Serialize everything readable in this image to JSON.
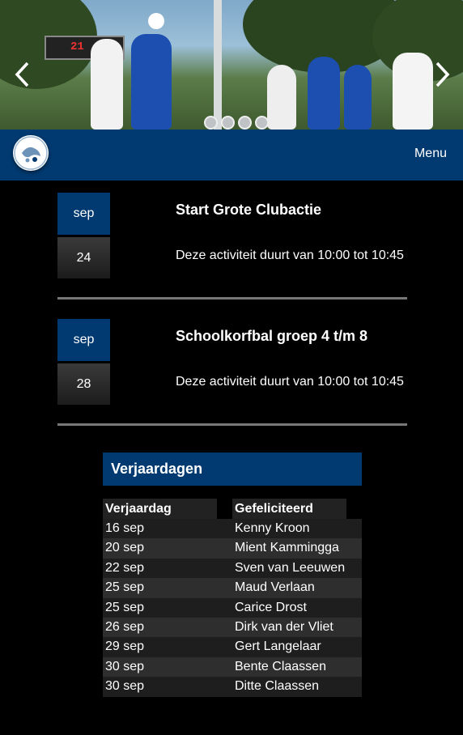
{
  "hero": {
    "score_board": "21",
    "dots": [
      1,
      2,
      3,
      4
    ]
  },
  "nav": {
    "menu_label": "Menu"
  },
  "events": [
    {
      "month": "sep",
      "day": "24",
      "title": "Start Grote Clubactie",
      "description": "Deze activiteit duurt van 10:00 tot 10:45"
    },
    {
      "month": "sep",
      "day": "28",
      "title": "Schoolkorfbal groep 4 t/m 8",
      "description": "Deze activiteit duurt van 10:00 tot 10:45"
    }
  ],
  "birthdays": {
    "heading": "Verjaardagen",
    "col_date": "Verjaardag",
    "col_name": "Gefeliciteerd",
    "rows": [
      {
        "date": "16 sep",
        "name": "Kenny Kroon"
      },
      {
        "date": "20 sep",
        "name": "Mient Kammingga"
      },
      {
        "date": "22 sep",
        "name": "Sven van Leeuwen"
      },
      {
        "date": "25 sep",
        "name": "Maud Verlaan"
      },
      {
        "date": "25 sep",
        "name": "Carice Drost"
      },
      {
        "date": "26 sep",
        "name": "Dirk van der Vliet"
      },
      {
        "date": "29 sep",
        "name": "Gert Langelaar"
      },
      {
        "date": "30 sep",
        "name": "Bente Claassen"
      },
      {
        "date": "30 sep",
        "name": "Ditte Claassen"
      }
    ]
  },
  "colors": {
    "brand_blue": "#003a70",
    "separator": "#777777"
  }
}
